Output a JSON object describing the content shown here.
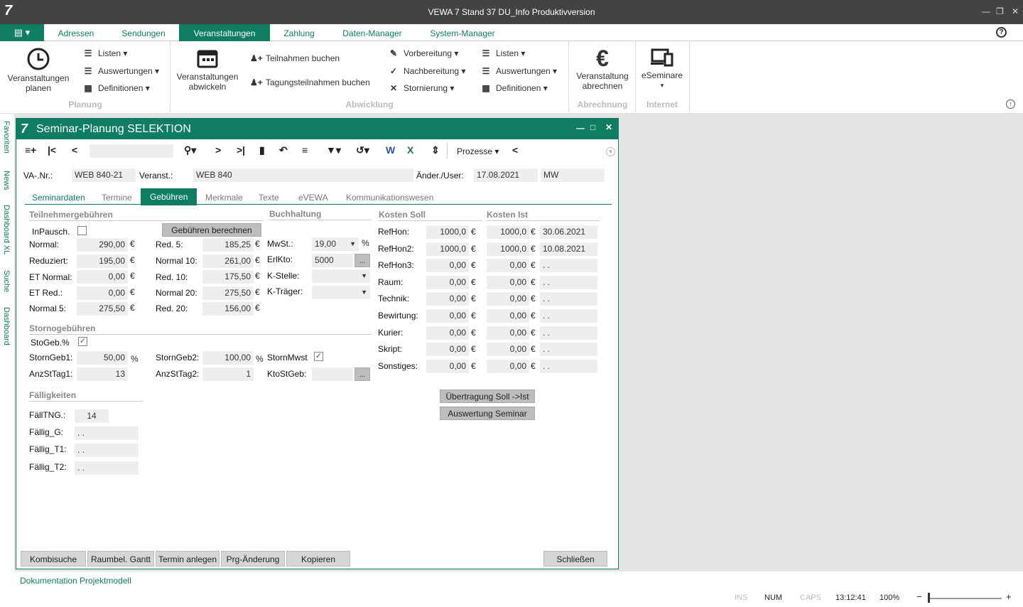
{
  "app": {
    "title": "VEWA 7 Stand 37 DU_Info Produktivversion",
    "logo": "7"
  },
  "menu": {
    "tabs": [
      "Adressen",
      "Sendungen",
      "Veranstaltungen",
      "Zahlung",
      "Daten-Manager",
      "System-Manager"
    ]
  },
  "ribbon": {
    "planung": {
      "big": "Veranstaltungen planen",
      "items": [
        "Listen",
        "Auswertungen",
        "Definitionen"
      ],
      "group": "Planung"
    },
    "abwicklung": {
      "big": "Veranstaltungen abwickeln",
      "book1": "Teilnahmen buchen",
      "book2": "Tagungsteilnahmen buchen",
      "items2": [
        "Vorbereitung",
        "Nachbereitung",
        "Stornierung"
      ],
      "items3": [
        "Listen",
        "Auswertungen",
        "Definitionen"
      ],
      "group": "Abwicklung"
    },
    "abrechnung": {
      "big": "Veranstaltung abrechnen",
      "group": "Abrechnung"
    },
    "internet": {
      "big": "eSeminare",
      "group": "Internet"
    }
  },
  "sidebar": [
    "Favoriten",
    "News",
    "Dashboard XL",
    "Suche",
    "Dashboard"
  ],
  "window": {
    "title": "Seminar-Planung SELEKTION",
    "prozesse": "Prozesse"
  },
  "header": {
    "va_label": "VA-.Nr.:",
    "va_value": "WEB 840-21",
    "veranst_label": "Veranst.:",
    "veranst_value": "WEB 840",
    "aender_label": "Änder./User:",
    "aender_date": "17.08.2021",
    "aender_user": "MW"
  },
  "tabs": [
    "Seminardaten",
    "Termine",
    "Gebühren",
    "Merkmale",
    "Texte",
    "eVEWA",
    "Kommunikationswesen"
  ],
  "tn": {
    "title": "Teilnehmergebühren",
    "inpausch": "InPausch.",
    "calc_button": "Gebühren berechnen",
    "left": [
      {
        "l": "Normal:",
        "v": "290,00"
      },
      {
        "l": "Reduziert:",
        "v": "195,00"
      },
      {
        "l": "ET Normal:",
        "v": "0,00"
      },
      {
        "l": "ET Red.:",
        "v": "0,00"
      },
      {
        "l": "Normal 5:",
        "v": "275,50"
      }
    ],
    "right": [
      {
        "l": "Red. 5:",
        "v": "185,25"
      },
      {
        "l": "Normal 10:",
        "v": "261,00"
      },
      {
        "l": "Red. 10:",
        "v": "175,50"
      },
      {
        "l": "Normal 20:",
        "v": "275,50"
      },
      {
        "l": "Red. 20:",
        "v": "156,00"
      }
    ],
    "currency": "€"
  },
  "buch": {
    "title": "Buchhaltung",
    "mwst_label": "MwSt.:",
    "mwst_value": "19,00",
    "pct": "%",
    "erl_label": "ErlKto:",
    "erl_value": "5000",
    "kst_label": "K-Stelle:",
    "ktr_label": "K-Träger:",
    "dots": "..."
  },
  "storno": {
    "title": "Stornogebühren",
    "sto_label": "StoGeb.%",
    "sg1_label": "StornGeb1:",
    "sg1_value": "50,00",
    "sg2_label": "StornGeb2:",
    "sg2_value": "100,00",
    "mwst_label": "StornMwst",
    "anz1_label": "AnzStTag1:",
    "anz1_value": "13",
    "anz2_label": "AnzStTag2:",
    "anz2_value": "1",
    "kto_label": "KtoStGeb:"
  },
  "faell": {
    "title": "Fälligkeiten",
    "rows": [
      {
        "l": "FällTNG.:",
        "v": "14"
      },
      {
        "l": "Fällig_G:",
        "v": ". ."
      },
      {
        "l": "Fällig_T1:",
        "v": ". ."
      },
      {
        "l": "Fällig_T2:",
        "v": ". ."
      }
    ]
  },
  "kosten": {
    "soll_title": "Kosten Soll",
    "ist_title": "Kosten Ist",
    "rows": [
      {
        "l": "RefHon:",
        "s": "1000,0",
        "i": "1000,0",
        "d": "30.06.2021"
      },
      {
        "l": "RefHon2:",
        "s": "1000,0",
        "i": "1000,0",
        "d": "10.08.2021"
      },
      {
        "l": "RefHon3:",
        "s": "0,00",
        "i": "0,00",
        "d": ". ."
      },
      {
        "l": "Raum:",
        "s": "0,00",
        "i": "0,00",
        "d": ". ."
      },
      {
        "l": "Technik:",
        "s": "0,00",
        "i": "0,00",
        "d": ". ."
      },
      {
        "l": "Bewirtung:",
        "s": "0,00",
        "i": "0,00",
        "d": ". ."
      },
      {
        "l": "Kurier:",
        "s": "0,00",
        "i": "0,00",
        "d": ". ."
      },
      {
        "l": "Skript:",
        "s": "0,00",
        "i": "0,00",
        "d": ". ."
      },
      {
        "l": "Sonstiges:",
        "s": "0,00",
        "i": "0,00",
        "d": ". ."
      }
    ],
    "btn1": "Übertragung Soll ->Ist",
    "btn2": "Auswertung Seminar"
  },
  "bottom": {
    "buttons": [
      "Kombisuche",
      "Raumbel. Gantt",
      "Termin anlegen",
      "Prg-Änderung",
      "Kopieren"
    ],
    "close": "Schließen"
  },
  "footer": {
    "link": "Dokumentation Projektmodell",
    "ins": "INS",
    "num": "NUM",
    "caps": "CAPS",
    "time": "13:12:41",
    "zoom": "100%"
  }
}
